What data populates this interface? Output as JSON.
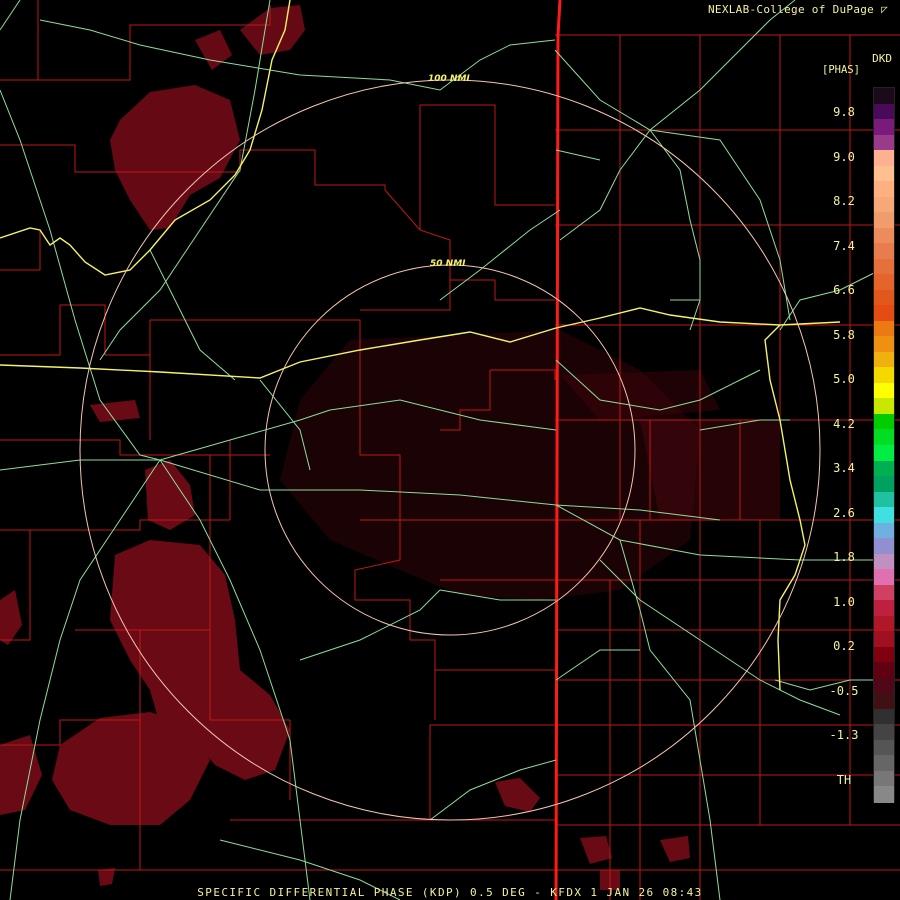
{
  "header": {
    "credit": "NEXLAB-College of DuPage",
    "credit_mark": "◸"
  },
  "colors": {
    "text": "#f4f29a",
    "county_line": "#c01818",
    "state_line": "#ff1a1a",
    "road": "#8fdc9a",
    "interstate": "#f3f36a",
    "range_ring": "#f3c6b0",
    "echo_dark": "#5c0a12",
    "echo_mid": "#7a0d18"
  },
  "range_rings": [
    {
      "label": "100 NMI"
    },
    {
      "label": "50 NMI"
    }
  ],
  "color_scale": {
    "code": "DKD",
    "unit_label": "[PHAS]",
    "ticks": [
      "9.8",
      "9.0",
      "8.2",
      "7.4",
      "6.6",
      "5.8",
      "5.0",
      "4.2",
      "3.4",
      "2.6",
      "1.8",
      "1.0",
      "0.2",
      "-0.5",
      "-1.3",
      "TH"
    ],
    "segments": [
      "#1a0a1a",
      "#4a0a5a",
      "#7a1a7a",
      "#9a3a8a",
      "#ffb090",
      "#ffc090",
      "#ffb080",
      "#f8a878",
      "#f09c6c",
      "#ec8c5c",
      "#e87c4c",
      "#e6703c",
      "#e4642c",
      "#e2581c",
      "#e44c14",
      "#ec7a14",
      "#f09010",
      "#f0b010",
      "#f5d800",
      "#ffff00",
      "#c8e800",
      "#00cc00",
      "#00dd22",
      "#00ee44",
      "#00b050",
      "#00a060",
      "#20c0a0",
      "#40e0e0",
      "#70b0e0",
      "#9090d0",
      "#c090c0",
      "#e070b0",
      "#d04060",
      "#c02040",
      "#b01828",
      "#a01020",
      "#800010",
      "#600010",
      "#500818",
      "#401014",
      "#303030",
      "#444444",
      "#555555",
      "#666666",
      "#777777",
      "#888888"
    ]
  },
  "footer": {
    "caption": "SPECIFIC DIFFERENTIAL PHASE (KDP) 0.5 DEG - KFDX 1 JAN 26 08:43"
  }
}
